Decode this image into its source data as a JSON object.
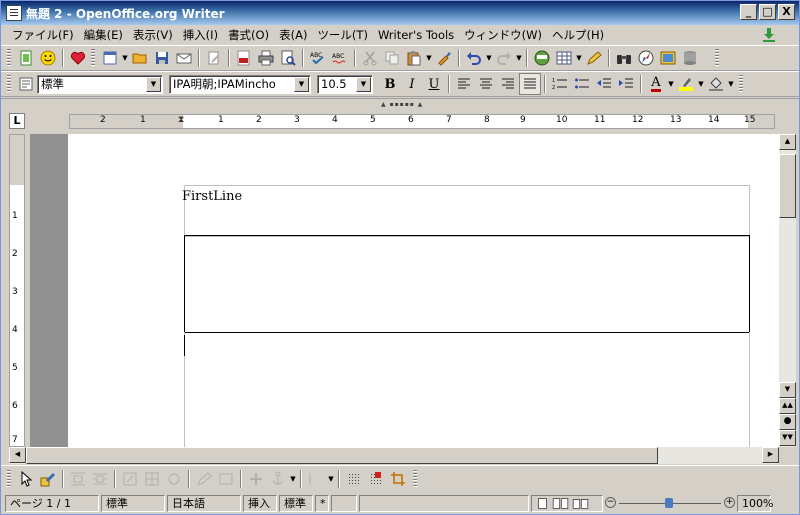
{
  "window": {
    "title": "無題 2 - OpenOffice.org Writer",
    "buttons": {
      "minimize": "_",
      "maximize": "□",
      "close": "X"
    }
  },
  "menubar": {
    "items": [
      "ファイル(F)",
      "編集(E)",
      "表示(V)",
      "挿入(I)",
      "書式(O)",
      "表(A)",
      "ツール(T)",
      "Writer's Tools",
      "ウィンドウ(W)",
      "ヘルプ(H)"
    ]
  },
  "formatting": {
    "paragraph_style": "標準",
    "font_name": "IPA明朝;IPAMincho",
    "font_size": "10.5",
    "bold": "B",
    "italic": "I",
    "underline": "U",
    "font_color_glyph": "A"
  },
  "ruler": {
    "h_ticks": [
      "2",
      "1",
      "1",
      "2",
      "3",
      "4",
      "5",
      "6",
      "7",
      "8",
      "9",
      "10",
      "11",
      "12",
      "13",
      "14",
      "15"
    ],
    "v_ticks": [
      "1",
      "2",
      "3",
      "4",
      "5",
      "6",
      "7"
    ],
    "corner_label": "L"
  },
  "document": {
    "first_line": "FirstLine"
  },
  "statusbar": {
    "page": "ページ 1 / 1",
    "style": "標準",
    "language": "日本語",
    "insert_mode": "挿入",
    "selection_mode": "標準",
    "modified": "*",
    "zoom": "100%"
  },
  "colors": {
    "titlebar_start": "#0a246a",
    "titlebar_end": "#a6caf0",
    "chrome": "#d4d0c8",
    "doc_background": "#909090"
  }
}
